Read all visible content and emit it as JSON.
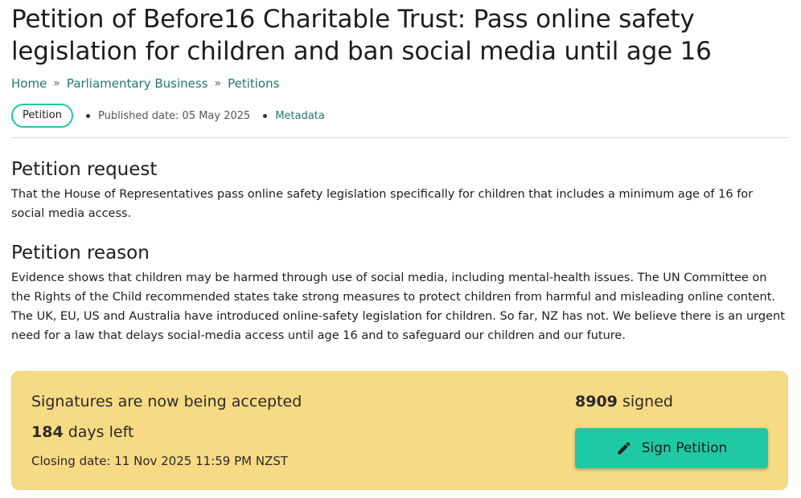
{
  "page": {
    "title": "Petition of Before16 Charitable Trust: Pass online safety legislation for children and ban social media until age 16"
  },
  "breadcrumb": {
    "items": [
      "Home",
      "Parliamentary Business",
      "Petitions"
    ],
    "separator": "»"
  },
  "meta": {
    "badge": "Petition",
    "published": "Published date: 05 May 2025",
    "metadata_link": "Metadata"
  },
  "request": {
    "heading": "Petition request",
    "text": "That the House of Representatives pass online safety legislation specifically for children that includes a minimum age of 16 for social media access."
  },
  "reason": {
    "heading": "Petition reason",
    "text": "Evidence shows that children may be harmed through use of social media, including mental-health issues. The UN Committee on the Rights of the Child recommended states take strong measures to protect children from harmful and misleading online content. The UK, EU, US and Australia have introduced online-safety legislation for children. So far, NZ has not. We believe there is an urgent need for a law that delays social-media access until age 16 and to safeguard our children and our future."
  },
  "signatures": {
    "status": "Signatures are now being accepted",
    "days_count": "184",
    "days_label": "days left",
    "closing": "Closing date: 11 Nov 2025 11:59 PM NZST",
    "signed_count": "8909",
    "signed_label": "signed",
    "button_label": "Sign Petition",
    "button_icon": "pencil-icon"
  },
  "colors": {
    "accent": "#1fc9a6",
    "link": "#1f7a64",
    "signature_box": "#f7da84"
  }
}
